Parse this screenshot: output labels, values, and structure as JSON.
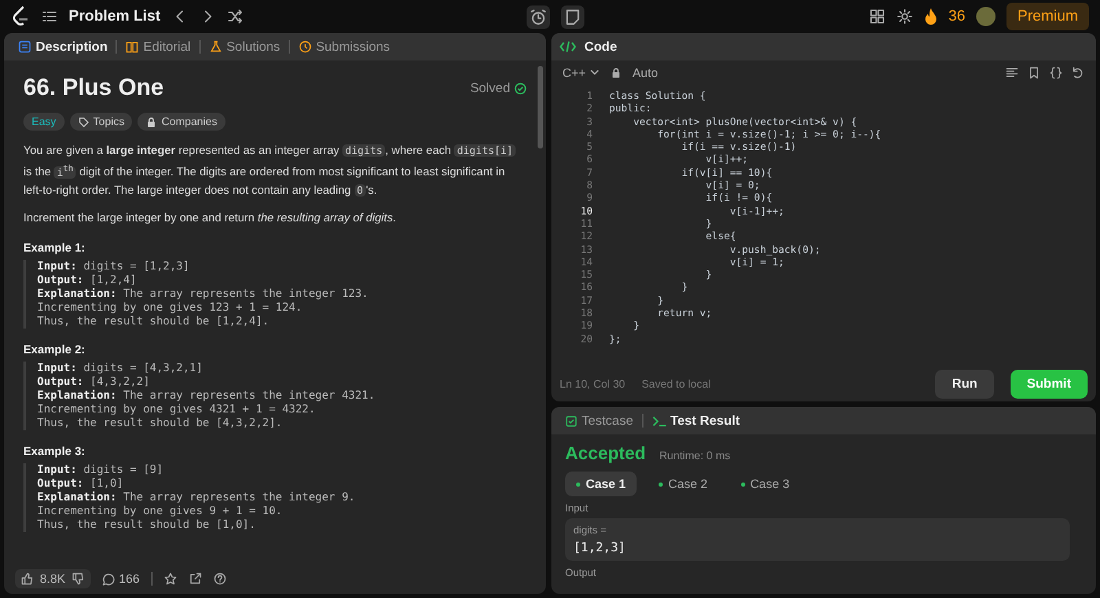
{
  "top_bar": {
    "problem_list": "Problem List",
    "streak": "36",
    "premium": "Premium"
  },
  "description_tabs": [
    {
      "label": "Description",
      "selected": true
    },
    {
      "label": "Editorial",
      "selected": false
    },
    {
      "label": "Solutions",
      "selected": false
    },
    {
      "label": "Submissions",
      "selected": false
    }
  ],
  "problem": {
    "title": "66. Plus One",
    "status": "Solved",
    "difficulty": "Easy",
    "tags": [
      "Topics",
      "Companies"
    ],
    "paragraphs": [
      [
        {
          "kind": "text",
          "text": "You are given a **large integer** represented as an integer array "
        },
        {
          "kind": "code",
          "text": "digits"
        },
        {
          "kind": "text",
          "text": ", where each "
        },
        {
          "kind": "code",
          "text": "digits[i]"
        },
        {
          "kind": "text",
          "text": " is the "
        },
        {
          "kind": "code",
          "text": "i$^{th}$"
        },
        {
          "kind": "text",
          "text": " digit of the integer. The digits are ordered from most significant to least significant in left-to-right order. The large integer does not contain any leading "
        },
        {
          "kind": "code",
          "text": "0"
        },
        {
          "kind": "text",
          "text": "'s."
        }
      ],
      [
        {
          "kind": "text",
          "text": "Increment the large integer by one and return *the resulting array of digits*."
        }
      ]
    ],
    "examples": [
      {
        "title": "Example 1:",
        "lines": [
          {
            "label": "Input:",
            "value": "digits = [1,2,3]"
          },
          {
            "label": "Output:",
            "value": "[1,2,4]"
          },
          {
            "label": "Explanation:",
            "value": "The array represents the integer 123."
          },
          {
            "value": "Incrementing by one gives 123 + 1 = 124."
          },
          {
            "value": "Thus, the result should be [1,2,4]."
          }
        ]
      },
      {
        "title": "Example 2:",
        "lines": [
          {
            "label": "Input:",
            "value": "digits = [4,3,2,1]"
          },
          {
            "label": "Output:",
            "value": "[4,3,2,2]"
          },
          {
            "label": "Explanation:",
            "value": "The array represents the integer 4321."
          },
          {
            "value": "Incrementing by one gives 4321 + 1 = 4322."
          },
          {
            "value": "Thus, the result should be [4,3,2,2]."
          }
        ]
      },
      {
        "title": "Example 3:",
        "lines": [
          {
            "label": "Input:",
            "value": "digits = [9]"
          },
          {
            "label": "Output:",
            "value": "[1,0]"
          },
          {
            "label": "Explanation:",
            "value": "The array represents the integer 9."
          },
          {
            "value": "Incrementing by one gives 9 + 1 = 10."
          },
          {
            "value": "Thus, the result should be [1,0]."
          }
        ]
      }
    ],
    "likes": "8.8K",
    "comments": "166"
  },
  "code_panel": {
    "title": "Code",
    "language": "C++",
    "mode": "Auto",
    "lines": [
      {
        "num": "1",
        "text": "class Solution {",
        "current": false
      },
      {
        "num": "2",
        "text": "public:",
        "current": false
      },
      {
        "num": "3",
        "text": "    vector<int> plusOne(vector<int>& v) {",
        "current": false
      },
      {
        "num": "4",
        "text": "        for(int i = v.size()-1; i >= 0; i--){",
        "current": false
      },
      {
        "num": "5",
        "text": "            if(i == v.size()-1)",
        "current": false
      },
      {
        "num": "6",
        "text": "                v[i]++;",
        "current": false
      },
      {
        "num": "7",
        "text": "            if(v[i] == 10){",
        "current": false
      },
      {
        "num": "8",
        "text": "                v[i] = 0;",
        "current": false
      },
      {
        "num": "9",
        "text": "                if(i != 0){",
        "current": false
      },
      {
        "num": "10",
        "text": "                    v[i-1]++;",
        "current": true
      },
      {
        "num": "11",
        "text": "                }",
        "current": false
      },
      {
        "num": "12",
        "text": "                else{",
        "current": false
      },
      {
        "num": "13",
        "text": "                    v.push_back(0);",
        "current": false
      },
      {
        "num": "14",
        "text": "                    v[i] = 1;",
        "current": false
      },
      {
        "num": "15",
        "text": "                }",
        "current": false
      },
      {
        "num": "16",
        "text": "            }",
        "current": false
      },
      {
        "num": "17",
        "text": "        }",
        "current": false
      },
      {
        "num": "18",
        "text": "        return v;",
        "current": false
      },
      {
        "num": "19",
        "text": "    }",
        "current": false
      },
      {
        "num": "20",
        "text": "};",
        "current": false
      }
    ],
    "cursor": "Ln 10, Col 30",
    "saved": "Saved to local",
    "run": "Run",
    "submit": "Submit"
  },
  "result_panel": {
    "tabs": [
      {
        "label": "Testcase",
        "selected": false
      },
      {
        "label": "Test Result",
        "selected": true
      }
    ],
    "verdict": "Accepted",
    "runtime": "Runtime: 0 ms",
    "cases": [
      {
        "label": "Case 1",
        "selected": true
      },
      {
        "label": "Case 2",
        "selected": false
      },
      {
        "label": "Case 3",
        "selected": false
      }
    ],
    "input_label": "Input",
    "input_name": "digits =",
    "input_value": "[1,2,3]",
    "output_label": "Output"
  }
}
